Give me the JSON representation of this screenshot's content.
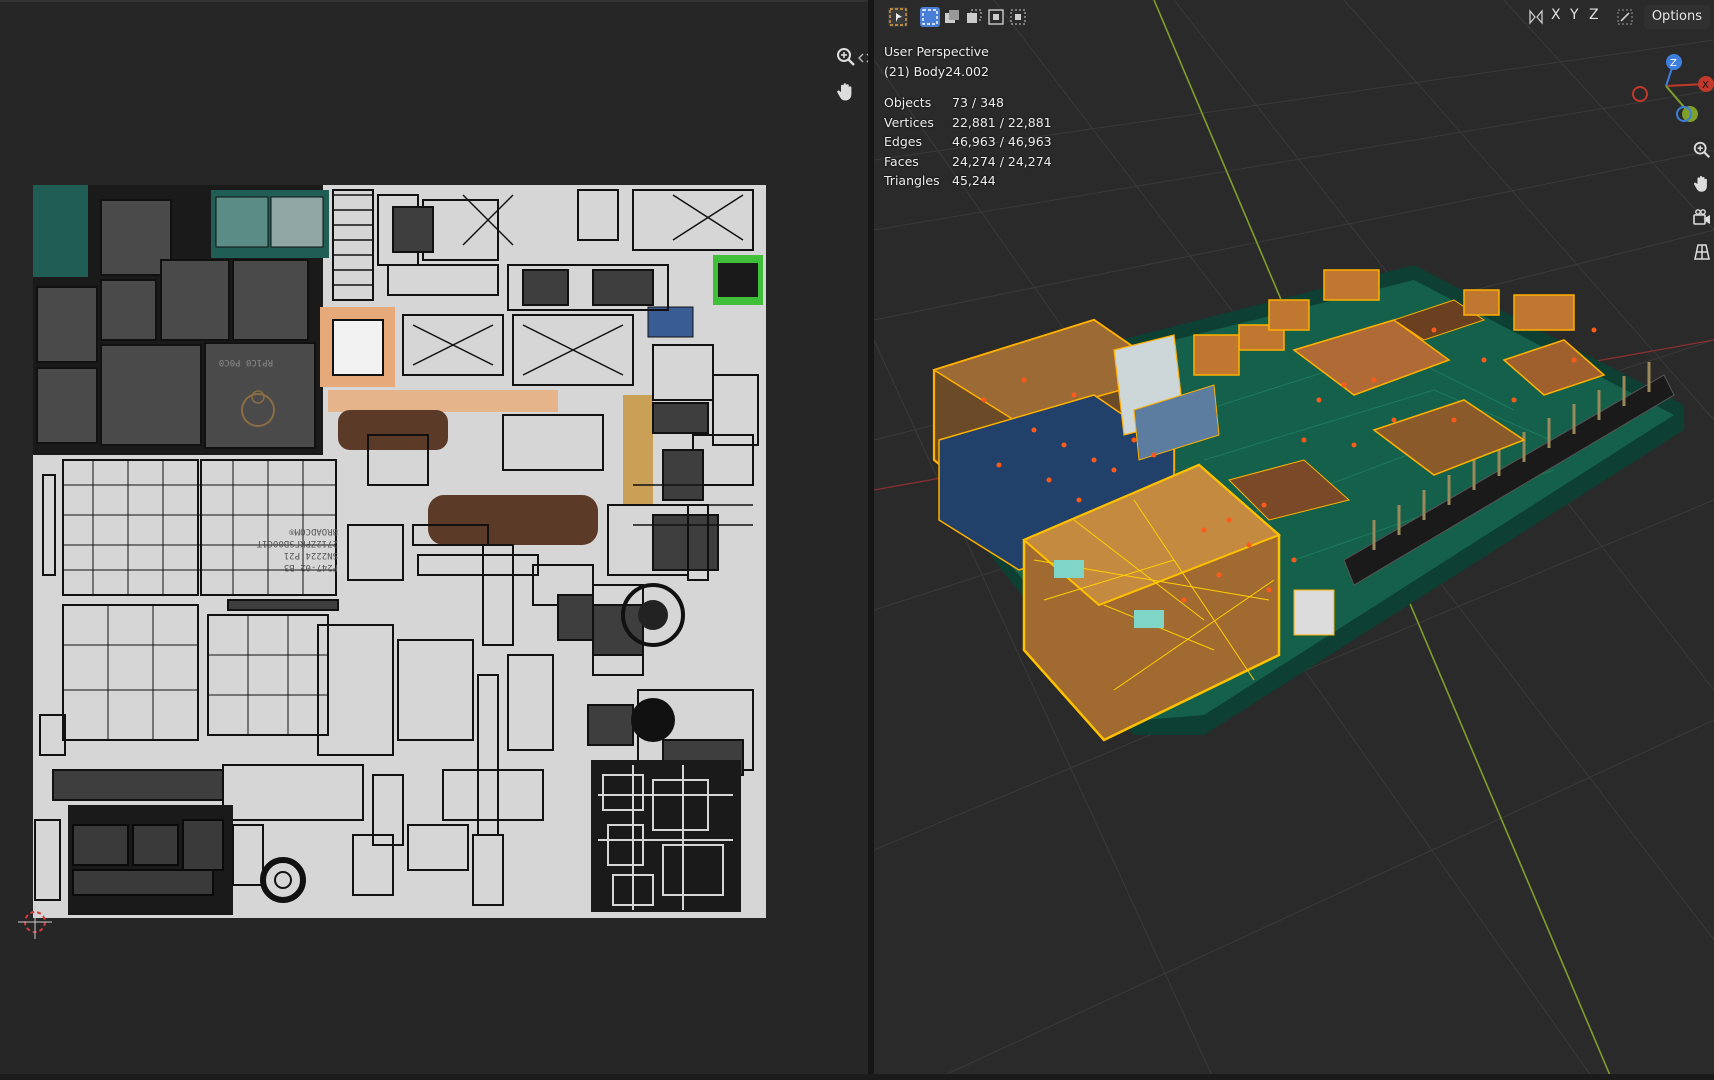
{
  "viewport": {
    "view_name": "User Perspective",
    "object_name": "(21) Body24.002",
    "stats": [
      {
        "label": "Objects",
        "value": "73 / 348"
      },
      {
        "label": "Vertices",
        "value": "22,881 / 22,881"
      },
      {
        "label": "Edges",
        "value": "46,963 / 46,963"
      },
      {
        "label": "Faces",
        "value": "24,274 / 24,274"
      },
      {
        "label": "Triangles",
        "value": "45,244"
      }
    ],
    "header": {
      "axis_x": "X",
      "axis_y": "Y",
      "axis_z": "Z",
      "options_label": "Options"
    },
    "gizmo": {
      "x": "X",
      "y": "Y",
      "z": "Z"
    }
  },
  "uv_texture": {
    "label_broadcom": "BROADCOM®",
    "label_part1": "2712ZPKFSB00C1T",
    "label_part2": "SN2224 P21",
    "label_part3": "F247-02 B3",
    "label_rp": "RP1C0 P0C0"
  },
  "colors": {
    "background": "#1d1d1d",
    "panel": "#262626",
    "viewport": "#2a2a2a",
    "selection": "#ffb000",
    "pcb_green": "#0f5a45",
    "axis_green": "#8bc34a",
    "axis_red": "#c0392b"
  },
  "icons": [
    "zoom-icon",
    "pan-icon",
    "select-mode-icon",
    "camera-icon",
    "grid-icon",
    "cursor-icon"
  ]
}
